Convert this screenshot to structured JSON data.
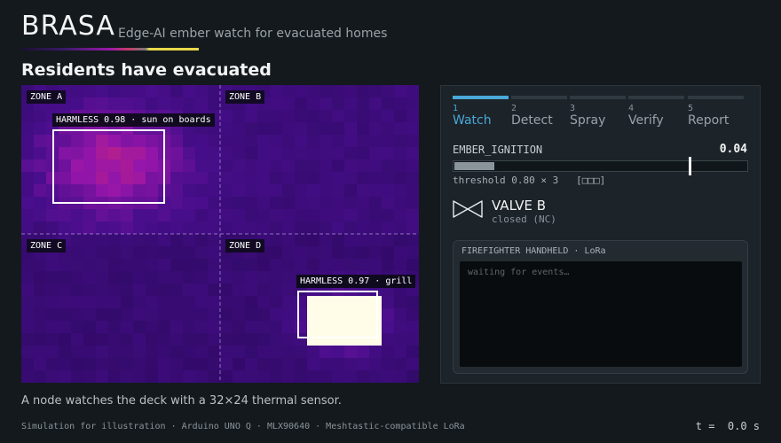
{
  "header": {
    "brand": "BRASA",
    "tagline": "Edge-AI ember watch for evacuated homes"
  },
  "headline": "Residents have evacuated",
  "thermal_view": {
    "zones": [
      "ZONE A",
      "ZONE B",
      "ZONE C",
      "ZONE D"
    ],
    "detections": [
      {
        "label": "HARMLESS 0.98 · sun on boards"
      },
      {
        "label": "HARMLESS 0.97 · grill"
      }
    ]
  },
  "pipeline": {
    "steps": [
      {
        "num": "1",
        "name": "Watch",
        "active": true
      },
      {
        "num": "2",
        "name": "Detect",
        "active": false
      },
      {
        "num": "3",
        "name": "Spray",
        "active": false
      },
      {
        "num": "4",
        "name": "Verify",
        "active": false
      },
      {
        "num": "5",
        "name": "Report",
        "active": false
      }
    ]
  },
  "metric": {
    "name": "EMBER_IGNITION",
    "value": "0.04",
    "level": 0.04,
    "threshold_level": 0.8,
    "threshold_text": "threshold 0.80 × 3   [□□□]"
  },
  "valve": {
    "name": "VALVE B",
    "status": "closed (NC)"
  },
  "radio": {
    "title": "FIREFIGHTER HANDHELD · LoRa",
    "placeholder": "waiting for events…"
  },
  "caption": "A node watches the deck with a 32×24 thermal sensor.",
  "footer": "Simulation for illustration · Arduino UNO Q · MLX90640 · Meshtastic-compatible LoRa",
  "clock": "t =  0.0 s",
  "colors": {
    "accent": "#4aa8d8",
    "thermal_base": "#2a0a5c",
    "thermal_warm": "#9a1aa8",
    "thermal_hot": "#fffbe8"
  }
}
